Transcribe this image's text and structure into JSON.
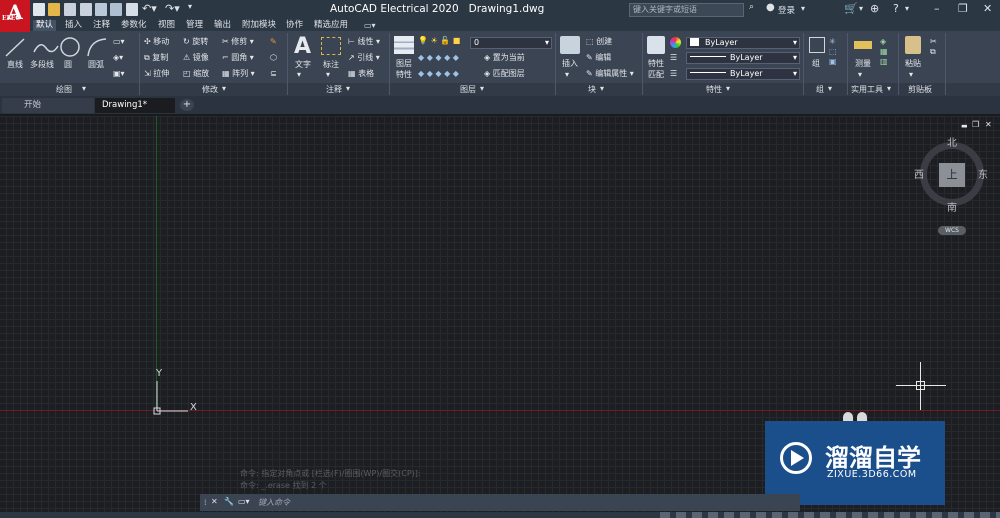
{
  "app": {
    "logo_letter": "A",
    "logo_sub": "ELEC",
    "title": "AutoCAD Electrical 2020",
    "file": "Drawing1.dwg"
  },
  "search": {
    "placeholder": "键入关键字或短语"
  },
  "user": {
    "login": "登录"
  },
  "tabs": [
    "默认",
    "插入",
    "注释",
    "参数化",
    "视图",
    "管理",
    "输出",
    "附加模块",
    "协作",
    "精选应用"
  ],
  "draw": {
    "line": "直线",
    "pline": "多段线",
    "circle": "圆",
    "arc": "圆弧",
    "panel": "绘图"
  },
  "modify": {
    "move": "移动",
    "rotate": "旋转",
    "trim": "修剪",
    "copy": "复制",
    "mirror": "镜像",
    "fillet": "圆角",
    "stretch": "拉伸",
    "scale": "缩放",
    "array": "阵列",
    "panel": "修改"
  },
  "annotation": {
    "text": "文字",
    "dim": "标注",
    "linear": "线性",
    "leader": "引线",
    "table": "表格",
    "panel": "注释"
  },
  "layers": {
    "props": "图层",
    "props2": "特性",
    "current": "0",
    "make_current": "置为当前",
    "match": "匹配图层",
    "panel": "图层"
  },
  "block": {
    "insert": "插入",
    "create": "创建",
    "edit": "编辑",
    "attr": "编辑属性",
    "panel": "块"
  },
  "properties": {
    "match": "特性",
    "match2": "匹配",
    "color": "ByLayer",
    "linetype": "ByLayer",
    "lineweight": "ByLayer",
    "panel": "特性"
  },
  "groups": {
    "group": "组",
    "panel": "组"
  },
  "utilities": {
    "measure": "测量",
    "panel": "实用工具"
  },
  "clipboard": {
    "paste": "粘贴",
    "panel": "剪贴板"
  },
  "doctabs": [
    "开始",
    "Drawing1*"
  ],
  "viewcube": {
    "north": "北",
    "south": "南",
    "east": "东",
    "west": "西",
    "top": "上",
    "wcs": "WCS"
  },
  "ucs": {
    "x": "X",
    "y": "Y"
  },
  "command": {
    "history1": "命令: 指定对角点或 [栏选(F)/圈围(WP)/圈交(CP)]:",
    "history2": "命令: _.erase 找到 2 个",
    "placeholder": "键入命令"
  },
  "watermark": {
    "title": "溜溜自学",
    "url": "ZIXUE.3D66.COM"
  },
  "colors": {
    "titlebar": "#2c3744",
    "ribbon": "#3b4453",
    "canvas": "#1c1e21",
    "accent_red": "#c8151f",
    "watermark": "#1b4f8c"
  }
}
